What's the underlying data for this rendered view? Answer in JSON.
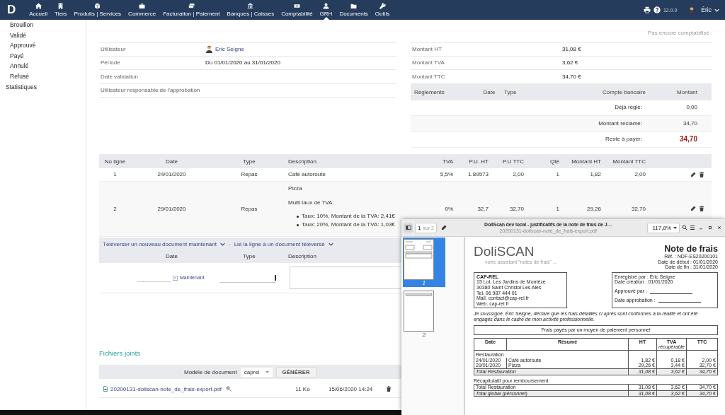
{
  "nav": {
    "logo": "D",
    "items": [
      {
        "label": "Accueil",
        "selected": false
      },
      {
        "label": "Tiers",
        "selected": false
      },
      {
        "label": "Produits | Services",
        "selected": false
      },
      {
        "label": "Commerce",
        "selected": false
      },
      {
        "label": "Facturation | Paiement",
        "selected": false
      },
      {
        "label": "Banques | Caisses",
        "selected": false
      },
      {
        "label": "Comptabilité",
        "selected": false
      },
      {
        "label": "GRH",
        "selected": true
      },
      {
        "label": "Documents",
        "selected": false
      },
      {
        "label": "Outils",
        "selected": false
      }
    ],
    "version": "12.0.0",
    "user": "Éric"
  },
  "sidebar": {
    "sub_items": [
      "Brouillon",
      "Validé",
      "Approuvé",
      "Payé",
      "Annulé",
      "Refusé"
    ],
    "items": [
      "Statistiques"
    ]
  },
  "fields": [
    {
      "label": "Utilisateur",
      "value": "Eric Seigne",
      "kind": "user"
    },
    {
      "label": "Période",
      "value": "Du 01/01/2020 au 31/01/2020",
      "kind": "text"
    },
    {
      "label": "Date validation",
      "kind": "text"
    },
    {
      "label": "Utilisateur responsable de l'approbation",
      "kind": "text"
    }
  ],
  "accounting_status": "Pas encore comptabilisé",
  "amounts": [
    {
      "label": "Montant HT",
      "value": "31,08 €"
    },
    {
      "label": "Montant TVA",
      "value": "3,62 €"
    },
    {
      "label": "Montant TTC",
      "value": "34,70 €"
    }
  ],
  "payments": {
    "columns": [
      "Règlements",
      "Date",
      "Type",
      "Compte bancaire",
      "Montant"
    ],
    "rows": [
      {
        "label": "Déjà réglé:",
        "value": "0,00",
        "kind": "normal"
      },
      {
        "label": "Montant réclamé:",
        "value": "34,70",
        "kind": "normal"
      },
      {
        "label": "Reste à payer:",
        "value": "34,70",
        "kind": "due"
      }
    ]
  },
  "lines": {
    "columns": [
      "No ligne",
      "Date",
      "Type",
      "Description",
      "TVA",
      "P.U. HT",
      "P.U TTC",
      "Qté",
      "Montant HT",
      "Montant TTC"
    ],
    "rows": [
      {
        "no": "1",
        "date": "24/01/2020",
        "type": "Repas",
        "description": "Café autoroute",
        "tva": "5,5%",
        "pu_ht": "1.89573",
        "pu_ttc": "2,00",
        "qty": "1",
        "total_ht": "1,82",
        "total_ttc": "2,00"
      },
      {
        "no": "2",
        "date": "29/01/2020",
        "type": "Repas",
        "description": "Pizza",
        "vat_note": "Multi taux de TVA:",
        "vat_rates": [
          "Taux: 10%, Montant de la TVA: 2,41€",
          "Taux: 20%, Montant de la TVA: 1,03€"
        ],
        "tva": "0%",
        "pu_ht": "32.7",
        "pu_ttc": "32,70",
        "qty": "1",
        "total_ht": "29,26",
        "total_ttc": "32,70"
      }
    ]
  },
  "upload": {
    "links": [
      "Téléverser un nouveau document maintenant",
      "Lié la ligne à un document téléversé"
    ],
    "separator": "-",
    "columns": [
      "Date",
      "Type",
      "Description"
    ],
    "now_button": "Maintenant"
  },
  "attachments": {
    "title": "Fichiers joints",
    "model_label": "Modèle de document",
    "model": "caprel",
    "generate": "GÉNÉRER",
    "files": [
      {
        "name": "20200131-doliscan-note_de_frais-export.pdf",
        "size": "11 Ko",
        "date": "15/06/2020 14:24"
      }
    ]
  },
  "pdf_viewer": {
    "page": "1",
    "page_count": "sur 2",
    "title": "DoliScan dev local - justificatifs de la note de frais de J…",
    "filename": "20200131-doliscan-note_de_frais-export.pdf",
    "zoom": "117,8%",
    "thumbnails": [
      {
        "label": "1",
        "selected": true
      },
      {
        "label": "2",
        "selected": false
      }
    ],
    "document": {
      "logo": "DoliSCAN",
      "tagline": "votre assistant \"notes de frais\" ...",
      "title": "Note de frais",
      "meta": [
        "Réf. : NDF-ES20200101",
        "Date de début : 01/01/2020",
        "Date de fin : 31/01/2020"
      ],
      "company": [
        "CAP-REL",
        "15 Lot. Les Jardins de Montèze",
        "30380 Saint Christol Les Alès",
        "Tel. 06 987 444 01",
        "Mail. contact@cap-rel.fr",
        "Web. cap-rel.fr"
      ],
      "registration": [
        "Enregistré par : Éric Seigne",
        "Date création : 01/01/2020"
      ],
      "approval": [
        "Approuvé par :",
        "Date approbation :"
      ],
      "statement": "Je soussigné, Éric Seigne, déclare que les frais détaillés ci après sont conformes à la réalité et ont été engagés dans le cadre de mon activité professionnelle.",
      "section_title": "Frais payés par un moyen de paiement personnel",
      "table": {
        "columns": [
          "Date",
          "Résumé",
          "HT",
          "TVA",
          "TTC"
        ],
        "tva_note": "récupérable",
        "category": "Restauration",
        "rows": [
          [
            "24/01/2020",
            "Café autoroute",
            "1,82 €",
            "0,18 €",
            "2,00 €"
          ],
          [
            "29/01/2020",
            "Pizza",
            "29,26 €",
            "3,44 €",
            "32,70 €"
          ]
        ],
        "total": [
          "Total Restauration",
          "31,08 €",
          "3,62 €",
          "34,70 €"
        ]
      },
      "recap": {
        "title": "Récapitulatif pour remboursement",
        "rows": [
          [
            "Total Restauration",
            "31,08 €",
            "3,62 €",
            "34,70 €"
          ],
          [
            "Total global (personnel)",
            "31,08 €",
            "3,62 €",
            "34,70 €"
          ]
        ]
      }
    }
  }
}
